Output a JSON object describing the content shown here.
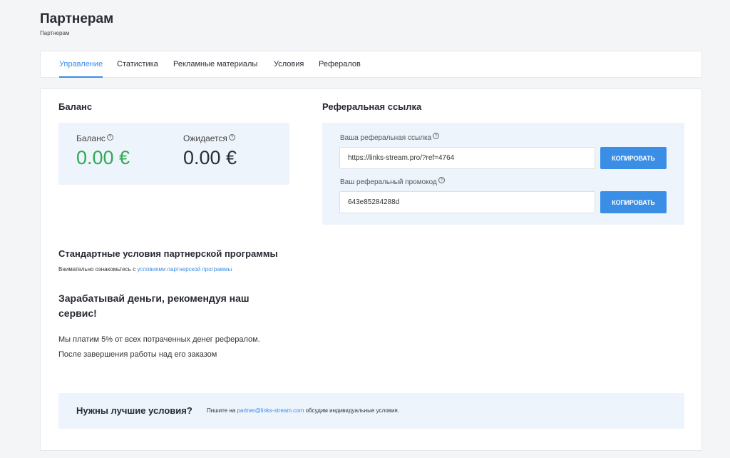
{
  "page": {
    "title": "Партнерам",
    "breadcrumb": "Партнерам"
  },
  "tabs": [
    {
      "label": "Управление",
      "active": true
    },
    {
      "label": "Статистика"
    },
    {
      "label": "Рекламные материалы"
    },
    {
      "label": "Условия"
    },
    {
      "label": "Рефералов"
    }
  ],
  "balance": {
    "heading": "Баланс",
    "balance_label": "Баланс",
    "balance_value": "0.00 €",
    "pending_label": "Ожидается",
    "pending_value": "0.00 €"
  },
  "referral": {
    "heading": "Реферальная ссылка",
    "link_label": "Ваша реферальная ссылка",
    "link_value": "https://links-stream.pro/?ref=4764",
    "promo_label": "Ваш реферальный промокод",
    "promo_value": "643e85284288d",
    "copy_label": "КОПИРОВАТЬ"
  },
  "standard": {
    "heading": "Стандартные условия партнерской программы",
    "sub_prefix": "Внимательно ознакомьтесь с",
    "sub_link": "условиями партнерской программы",
    "earn_title": "Зарабатывай деньги, рекомендуя наш сервис!",
    "earn_text": "Мы платим 5% от всех потраченных денег рефералом. После завершения работы над его заказом"
  },
  "better": {
    "title": "Нужны лучшие условия?",
    "text_prefix": "Пишите на",
    "email": "partner@links-stream.com",
    "text_suffix": "обсудим индивидуальные условия."
  },
  "colors": {
    "accent": "#3a8ee6",
    "green": "#2eab54",
    "panel_bg": "#eef4fb"
  },
  "icons": {
    "help": "question-circle-icon"
  }
}
